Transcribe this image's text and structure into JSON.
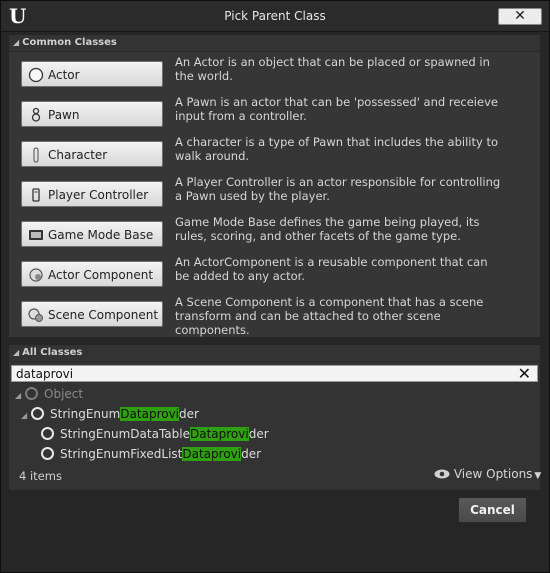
{
  "window": {
    "title": "Pick Parent Class",
    "close_label": "✕"
  },
  "common": {
    "header": "Common Classes",
    "items": [
      {
        "label": "Actor",
        "icon": "actor-sphere-icon",
        "desc": "An Actor is an object that can be placed or spawned in the world."
      },
      {
        "label": "Pawn",
        "icon": "pawn-icon",
        "desc": "A Pawn is an actor that can be 'possessed' and receieve input from a controller."
      },
      {
        "label": "Character",
        "icon": "character-icon",
        "desc": "A character is a type of Pawn that includes the ability to walk around."
      },
      {
        "label": "Player Controller",
        "icon": "player-controller-icon",
        "desc": "A Player Controller is an actor responsible for controlling a Pawn used by the player."
      },
      {
        "label": "Game Mode Base",
        "icon": "game-mode-icon",
        "desc": "Game Mode Base defines the game being played, its rules, scoring, and other facets of the game type."
      },
      {
        "label": "Actor Component",
        "icon": "actor-component-icon",
        "desc": "An ActorComponent is a reusable component that can be added to any actor."
      },
      {
        "label": "Scene Component",
        "icon": "scene-component-icon",
        "desc": "A Scene Component is a component that has a scene transform and can be attached to other scene components."
      }
    ]
  },
  "all": {
    "header": "All Classes",
    "search_value": "dataprovi",
    "tree": {
      "root": "Object",
      "child": {
        "prefix": "StringEnum",
        "match": "Dataprovi",
        "suffix": "der"
      },
      "grandchildren": [
        {
          "prefix": "StringEnumDataTable",
          "match": "Dataprovi",
          "suffix": "der"
        },
        {
          "prefix": "StringEnumFixedList",
          "match": "Dataprovi",
          "suffix": "der"
        }
      ]
    },
    "count_text": "4 items",
    "view_options_label": "View Options"
  },
  "footer": {
    "cancel_label": "Cancel"
  },
  "colors": {
    "highlight": "#2fa012",
    "background": "#262626"
  }
}
